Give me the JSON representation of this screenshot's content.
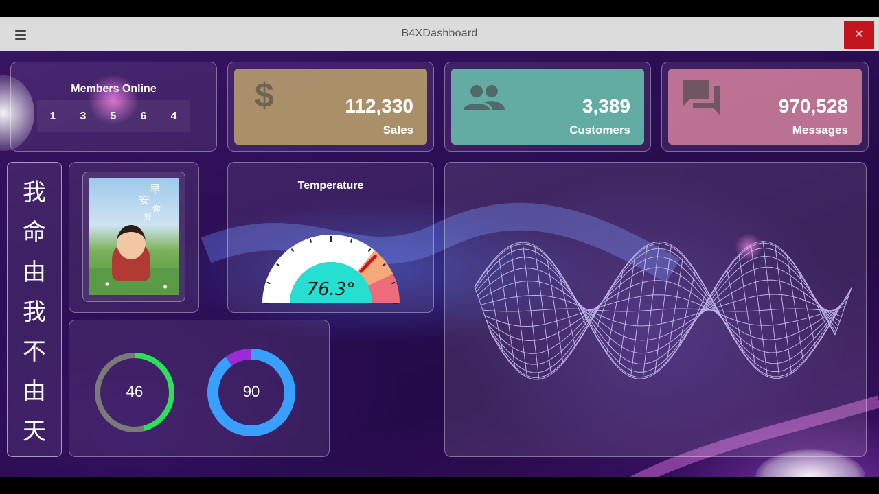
{
  "window": {
    "title": "B4XDashboard",
    "close_glyph": "✕",
    "menu_icon": "hamburger-icon"
  },
  "members": {
    "title": "Members Online",
    "digits": [
      "1",
      "3",
      "5",
      "6",
      "4"
    ]
  },
  "stats": [
    {
      "value": "112,330",
      "label": "Sales",
      "icon": "dollar-icon",
      "color": "#c8b06a"
    },
    {
      "value": "3,389",
      "label": "Customers",
      "icon": "people-icon",
      "color": "#6ed3b5"
    },
    {
      "value": "970,528",
      "label": "Messages",
      "icon": "chat-icon",
      "color": "#e08aa2"
    }
  ],
  "vertical_text": [
    "我",
    "命",
    "由",
    "我",
    "不",
    "由",
    "天"
  ],
  "image_card": {
    "overlay_text": [
      "早",
      "安",
      "你",
      "好"
    ]
  },
  "temperature": {
    "title": "Temperature",
    "value_text": "76.3°",
    "value": 76.3,
    "needle_fraction": 0.74,
    "face_color": "#25e0d0"
  },
  "rings": [
    {
      "value": "46",
      "fraction": 0.46,
      "color": "#2de05a",
      "track": "#7a7a7a"
    },
    {
      "value": "90",
      "fraction": 0.9,
      "color": "#3aa0ff",
      "remainder_color": "#9a2bd6"
    }
  ]
}
